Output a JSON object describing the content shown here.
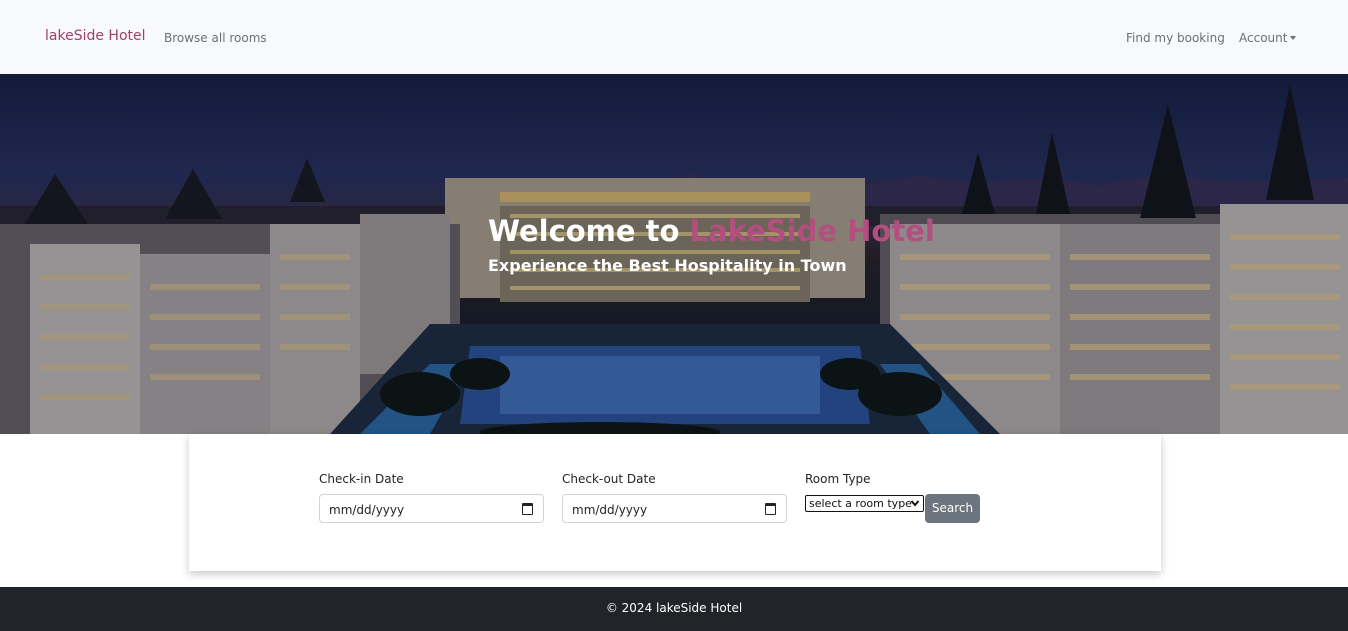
{
  "navbar": {
    "brand": "lakeSide Hotel",
    "browse_link": "Browse all rooms",
    "find_booking_link": "Find my booking",
    "account_menu": "Account"
  },
  "hero": {
    "title_prefix": "Welcome to ",
    "title_accent": "LakeSide Hotel",
    "subtitle": "Experience the Best Hospitality in Town"
  },
  "search": {
    "checkin_label": "Check-in Date",
    "checkin_value": "mm/dd/yyyy",
    "checkout_label": "Check-out Date",
    "checkout_value": "mm/dd/yyyy",
    "room_type_label": "Room Type",
    "room_type_selected": "select a room type",
    "search_button": "Search"
  },
  "footer": {
    "text": "© 2024 lakeSide Hotel"
  },
  "colors": {
    "brand": "#a13f6b",
    "accent": "#b34f7e",
    "navbar_bg": "#f8f9fa",
    "footer_bg": "#212529",
    "button_bg": "#6c757d"
  },
  "icons": {
    "calendar": "calendar-icon",
    "dropdown": "chevron-down-icon",
    "account_caret": "caret-down-icon"
  }
}
